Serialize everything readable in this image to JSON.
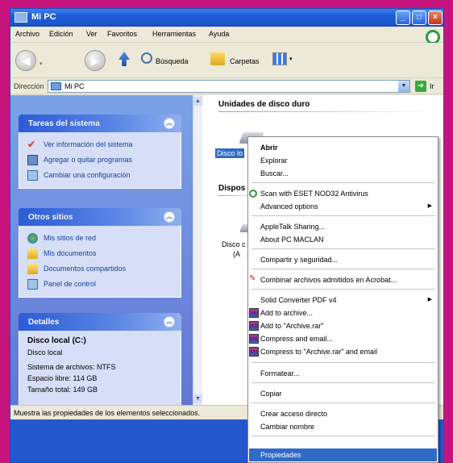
{
  "window": {
    "title": "Mi PC"
  },
  "menu": [
    "Archivo",
    "Edición",
    "Ver",
    "Favoritos",
    "Herramientas",
    "Ayuda"
  ],
  "toolbar": {
    "search_label": "Búsqueda",
    "folders_label": "Carpetas"
  },
  "address": {
    "label": "Dirección",
    "value": "Mi PC",
    "go_label": "Ir"
  },
  "left": {
    "tasks": {
      "title": "Tareas del sistema",
      "items": [
        "Ver información del sistema",
        "Agregar o quitar programas",
        "Cambiar una configuración"
      ]
    },
    "places": {
      "title": "Otros sitios",
      "items": [
        "Mis sitios de red",
        "Mis documentos",
        "Documentos compartidos",
        "Panel de control"
      ]
    },
    "details": {
      "title": "Detalles",
      "name": "Disco local (C:)",
      "type": "Disco local",
      "fs": "Sistema de archivos: NTFS",
      "free": "Espacio libre: 114 GB",
      "total": "Tamaño total: 149 GB"
    }
  },
  "main": {
    "hdd_title": "Unidades de disco duro",
    "hdd_item": "Disco lo",
    "removable_title": "Dispos",
    "removable_item_1": "Disco c",
    "removable_item_2": "(A"
  },
  "status": "Muestra las propiedades de los elementos seleccionados.",
  "context_menu": {
    "open": "Abrir",
    "explore": "Explorar",
    "search": "Buscar...",
    "eset": "Scan with ESET NOD32 Antivirus",
    "advanced": "Advanced options",
    "appletalk": "AppleTalk Sharing...",
    "about": "About PC MACLAN",
    "share": "Compartir y seguridad...",
    "acrobat": "Combinar archivos admitidos en Acrobat...",
    "solid": "Solid Converter PDF v4",
    "add_archive": "Add to archive...",
    "add_rar": "Add to \"Archive.rar\"",
    "compress_email": "Compress and email...",
    "compress_rar_email": "Compress to \"Archive.rar\" and email",
    "format": "Formatear...",
    "copy": "Copiar",
    "shortcut": "Crear acceso directo",
    "rename": "Cambiar nombre",
    "properties": "Propiedades"
  },
  "colors": {
    "frame": "#c8147d",
    "titlebar": "#1f5bd8",
    "selection": "#316ac5"
  }
}
